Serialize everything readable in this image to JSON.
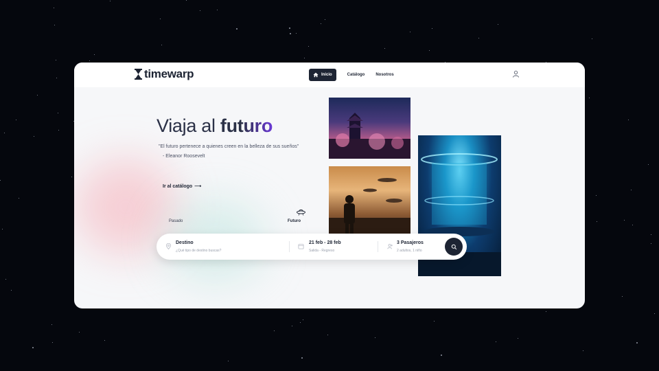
{
  "brand": {
    "name": "timewarp"
  },
  "nav": {
    "items": [
      {
        "label": "Inicio",
        "active": true
      },
      {
        "label": "Catálogo",
        "active": false
      },
      {
        "label": "Nosotros",
        "active": false
      }
    ]
  },
  "hero": {
    "title_plain": "Viaja al",
    "title_bold": "futuro",
    "quote": "\"El futuro pertenece a quienes creen en la belleza de sus sueños\"",
    "author": "- Eleanor Roosevelt",
    "cta": "Ir al catálogo",
    "cta_arrow": "⟶"
  },
  "time_selector": {
    "past": "Pasado",
    "future": "Futuro"
  },
  "search": {
    "destination_label": "Destino",
    "destination_placeholder": "¿Qué tipo de destino buscas?",
    "dates_value": "21 feb - 28 feb",
    "dates_sub": "Salida - Regreso",
    "passengers_value": "3 Pasajeros",
    "passengers_sub": "2 adultos, 1 niño"
  },
  "colors": {
    "primary": "#1d2433",
    "accent": "#6a38d6",
    "background": "#f6f7f9"
  }
}
